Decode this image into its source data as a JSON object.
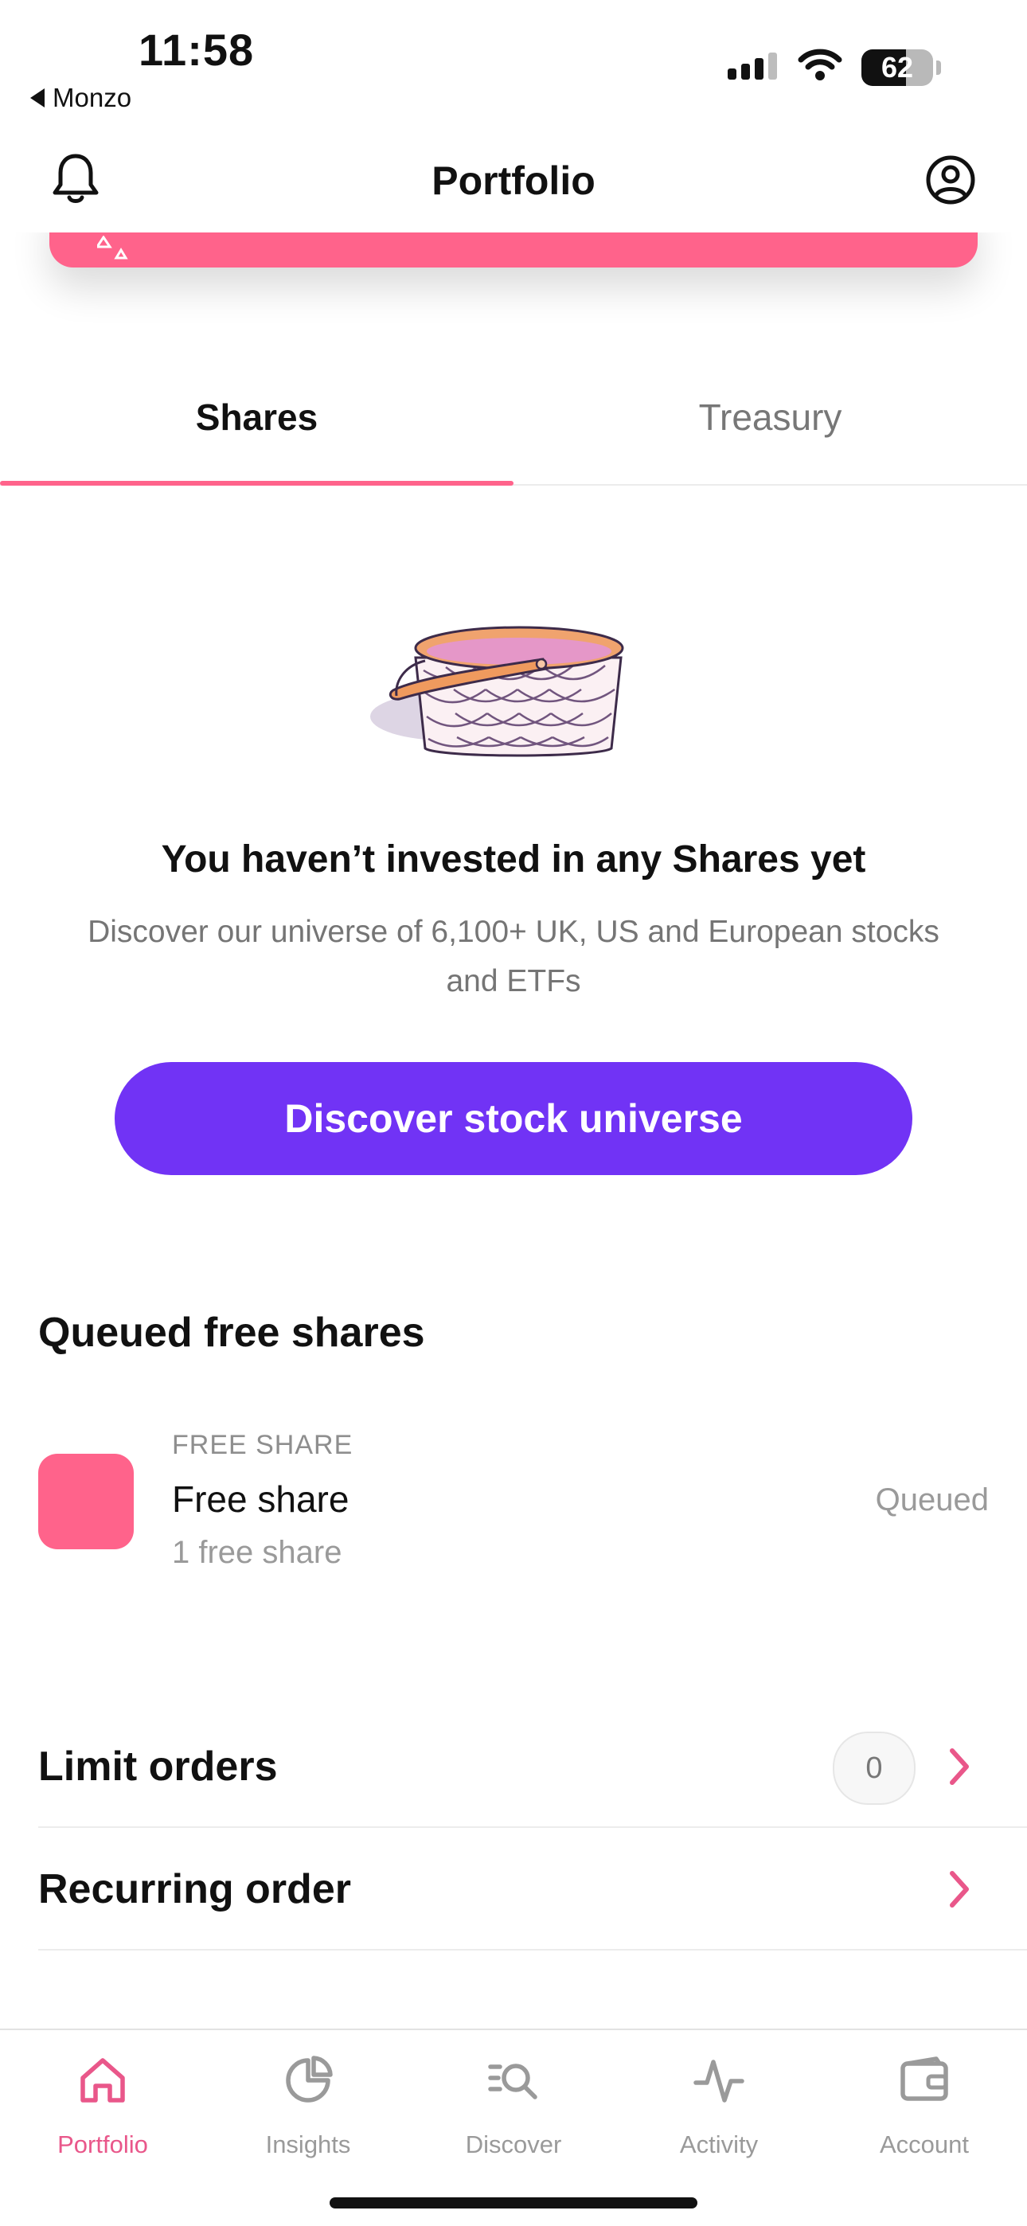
{
  "status_bar": {
    "time": "11:58",
    "back_app": "Monzo",
    "battery_level": "62"
  },
  "header": {
    "title": "Portfolio",
    "left_icon": "bell-icon",
    "right_icon": "profile-icon"
  },
  "tabs": [
    {
      "label": "Shares",
      "selected": true
    },
    {
      "label": "Treasury",
      "selected": false
    }
  ],
  "empty_state": {
    "illustration": "basket-illustration",
    "title": "You haven’t invested in any Shares yet",
    "subtitle": "Discover our universe of 6,100+ UK, US and European stocks and ETFs",
    "cta_label": "Discover stock universe"
  },
  "queued": {
    "section_title": "Queued free shares",
    "items": [
      {
        "kicker": "FREE SHARE",
        "name": "Free share",
        "subtitle": "1 free share",
        "status": "Queued"
      }
    ]
  },
  "rows": {
    "limit_orders": {
      "label": "Limit orders",
      "count": "0"
    },
    "recurring_order": {
      "label": "Recurring order"
    }
  },
  "tabbar": [
    {
      "label": "Portfolio",
      "icon": "home-icon",
      "active": true
    },
    {
      "label": "Insights",
      "icon": "pie-chart-icon",
      "active": false
    },
    {
      "label": "Discover",
      "icon": "discover-search-icon",
      "active": false
    },
    {
      "label": "Activity",
      "icon": "activity-pulse-icon",
      "active": false
    },
    {
      "label": "Account",
      "icon": "wallet-icon",
      "active": false
    }
  ],
  "colors": {
    "accent_pink": "#ff638b",
    "cta_purple": "#7133f5",
    "tab_active": "#e9578a",
    "muted_text": "#9a9a9a"
  }
}
